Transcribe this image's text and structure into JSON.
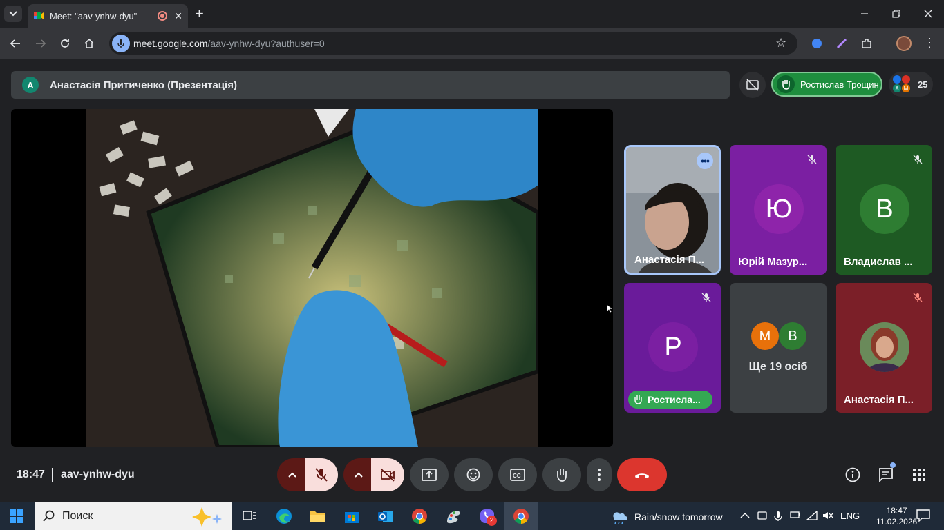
{
  "browser": {
    "tab_title": "Meet: \"aav-ynhw-dyu\"",
    "tab_close": "✕",
    "new_tab": "+",
    "url_host": "meet.google.com",
    "url_path": "/aav-ynhw-dyu?authuser=0"
  },
  "meet": {
    "presenter_initial": "A",
    "presenter_label": "Анастасія Притиченко (Презентація)",
    "raised_hand_name": "Ростислав Трощин",
    "participant_count": "25",
    "people_stack_letters": [
      "A",
      "M"
    ],
    "tiles": [
      {
        "name": "Анастасія П...",
        "type": "video"
      },
      {
        "name": "Юрій Мазур...",
        "letter": "Ю",
        "bg": "#7b1fa2",
        "avatar_bg": "#8e24aa"
      },
      {
        "name": "Владислав ...",
        "letter": "В",
        "bg": "#1e5a23",
        "avatar_bg": "#2e7d32"
      },
      {
        "name": "Ростисла...",
        "letter": "Р",
        "bg": "#6a1b9a",
        "avatar_bg": "#7b1fa2"
      },
      {
        "more_text": "Ще 19 осіб",
        "letters": [
          "М",
          "В"
        ]
      },
      {
        "name": "Анастасія П...",
        "bg": "#7b1f28",
        "type": "photo"
      }
    ],
    "time": "18:47",
    "meeting_code": "aav-ynhw-dyu"
  },
  "taskbar": {
    "search_placeholder": "Поиск",
    "weather": "Rain/snow tomorrow",
    "lang": "ENG",
    "clock_time": "18:47",
    "clock_date": "11.02.2026",
    "viber_badge": "2"
  },
  "colors": {
    "accent_blue": "#8ab4f8",
    "leave_red": "#dc362e",
    "mic_off_bg": "#f9dedc",
    "hand_green": "#1e8e3e"
  }
}
